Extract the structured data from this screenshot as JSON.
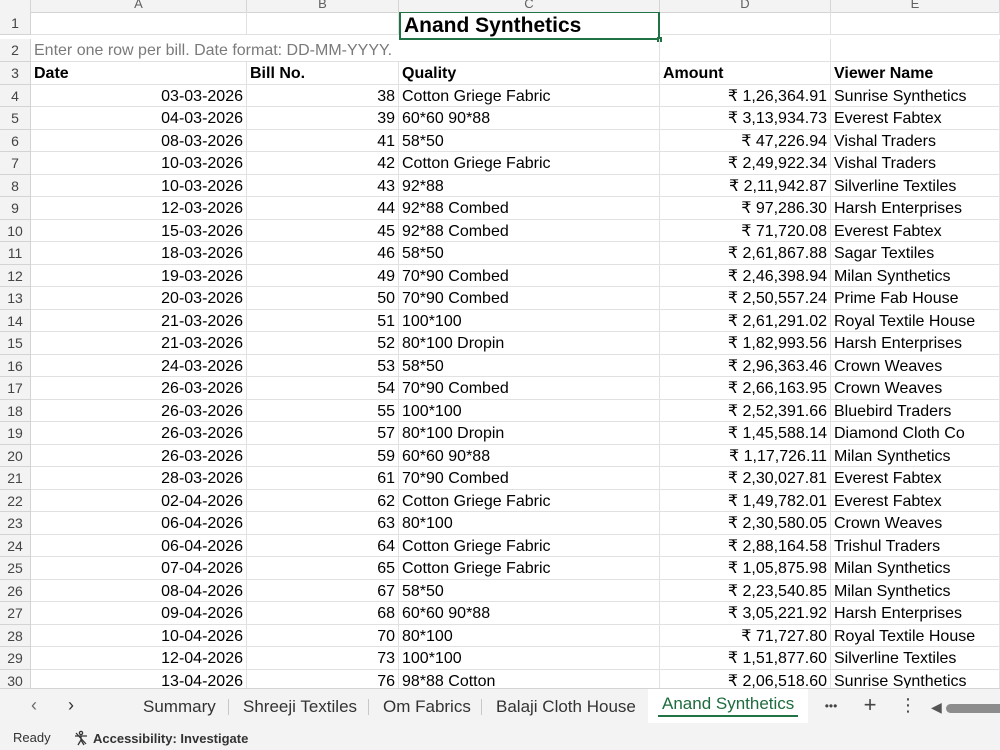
{
  "columns": [
    "A",
    "B",
    "C",
    "D",
    "E"
  ],
  "title": "Anand Synthetics",
  "note": "Enter one row per bill. Date format: DD-MM-YYYY.",
  "headers": {
    "date": "Date",
    "bill": "Bill No.",
    "quality": "Quality",
    "amount": "Amount",
    "viewer": "Viewer Name"
  },
  "rows": [
    {
      "date": "03-03-2026",
      "bill": "38",
      "quality": "Cotton Griege Fabric",
      "amount": "₹ 1,26,364.91",
      "viewer": "Sunrise Synthetics"
    },
    {
      "date": "04-03-2026",
      "bill": "39",
      "quality": "60*60 90*88",
      "amount": "₹ 3,13,934.73",
      "viewer": "Everest Fabtex"
    },
    {
      "date": "08-03-2026",
      "bill": "41",
      "quality": "58*50",
      "amount": "₹ 47,226.94",
      "viewer": "Vishal Traders"
    },
    {
      "date": "10-03-2026",
      "bill": "42",
      "quality": "Cotton Griege Fabric",
      "amount": "₹ 2,49,922.34",
      "viewer": "Vishal Traders"
    },
    {
      "date": "10-03-2026",
      "bill": "43",
      "quality": "92*88",
      "amount": "₹ 2,11,942.87",
      "viewer": "Silverline Textiles"
    },
    {
      "date": "12-03-2026",
      "bill": "44",
      "quality": "92*88 Combed",
      "amount": "₹ 97,286.30",
      "viewer": "Harsh Enterprises"
    },
    {
      "date": "15-03-2026",
      "bill": "45",
      "quality": "92*88 Combed",
      "amount": "₹ 71,720.08",
      "viewer": "Everest Fabtex"
    },
    {
      "date": "18-03-2026",
      "bill": "46",
      "quality": "58*50",
      "amount": "₹ 2,61,867.88",
      "viewer": "Sagar Textiles"
    },
    {
      "date": "19-03-2026",
      "bill": "49",
      "quality": "70*90 Combed",
      "amount": "₹ 2,46,398.94",
      "viewer": "Milan Synthetics"
    },
    {
      "date": "20-03-2026",
      "bill": "50",
      "quality": "70*90 Combed",
      "amount": "₹ 2,50,557.24",
      "viewer": "Prime Fab House"
    },
    {
      "date": "21-03-2026",
      "bill": "51",
      "quality": "100*100",
      "amount": "₹ 2,61,291.02",
      "viewer": "Royal Textile House"
    },
    {
      "date": "21-03-2026",
      "bill": "52",
      "quality": "80*100 Dropin",
      "amount": "₹ 1,82,993.56",
      "viewer": "Harsh Enterprises"
    },
    {
      "date": "24-03-2026",
      "bill": "53",
      "quality": "58*50",
      "amount": "₹ 2,96,363.46",
      "viewer": "Crown Weaves"
    },
    {
      "date": "26-03-2026",
      "bill": "54",
      "quality": "70*90 Combed",
      "amount": "₹ 2,66,163.95",
      "viewer": "Crown Weaves"
    },
    {
      "date": "26-03-2026",
      "bill": "55",
      "quality": "100*100",
      "amount": "₹ 2,52,391.66",
      "viewer": "Bluebird Traders"
    },
    {
      "date": "26-03-2026",
      "bill": "57",
      "quality": "80*100 Dropin",
      "amount": "₹ 1,45,588.14",
      "viewer": "Diamond Cloth Co"
    },
    {
      "date": "26-03-2026",
      "bill": "59",
      "quality": "60*60 90*88",
      "amount": "₹ 1,17,726.11",
      "viewer": "Milan Synthetics"
    },
    {
      "date": "28-03-2026",
      "bill": "61",
      "quality": "70*90 Combed",
      "amount": "₹ 2,30,027.81",
      "viewer": "Everest Fabtex"
    },
    {
      "date": "02-04-2026",
      "bill": "62",
      "quality": "Cotton Griege Fabric",
      "amount": "₹ 1,49,782.01",
      "viewer": "Everest Fabtex"
    },
    {
      "date": "06-04-2026",
      "bill": "63",
      "quality": "80*100",
      "amount": "₹ 2,30,580.05",
      "viewer": "Crown Weaves"
    },
    {
      "date": "06-04-2026",
      "bill": "64",
      "quality": "Cotton Griege Fabric",
      "amount": "₹ 2,88,164.58",
      "viewer": "Trishul Traders"
    },
    {
      "date": "07-04-2026",
      "bill": "65",
      "quality": "Cotton Griege Fabric",
      "amount": "₹ 1,05,875.98",
      "viewer": "Milan Synthetics"
    },
    {
      "date": "08-04-2026",
      "bill": "67",
      "quality": "58*50",
      "amount": "₹ 2,23,540.85",
      "viewer": "Milan Synthetics"
    },
    {
      "date": "09-04-2026",
      "bill": "68",
      "quality": "60*60 90*88",
      "amount": "₹ 3,05,221.92",
      "viewer": "Harsh Enterprises"
    },
    {
      "date": "10-04-2026",
      "bill": "70",
      "quality": "80*100",
      "amount": "₹ 71,727.80",
      "viewer": "Royal Textile House"
    },
    {
      "date": "12-04-2026",
      "bill": "73",
      "quality": "100*100",
      "amount": "₹ 1,51,877.60",
      "viewer": "Silverline Textiles"
    },
    {
      "date": "13-04-2026",
      "bill": "76",
      "quality": "98*88 Cotton",
      "amount": "₹ 2,06,518.60",
      "viewer": "Sunrise Synthetics"
    }
  ],
  "sheet_tabs": [
    "Summary",
    "Shreeji Textiles",
    "Om Fabrics",
    "Balaji Cloth House",
    "Anand Synthetics"
  ],
  "active_tab": "Anand Synthetics",
  "nav": {
    "prev": "‹",
    "next": "›",
    "more": "•••",
    "add": "+",
    "options": "⋮",
    "scroll_left": "◀"
  },
  "status": {
    "ready": "Ready",
    "accessibility": "Accessibility: Investigate"
  },
  "colors": {
    "accent": "#217346",
    "header_bg": "#f3f3f3",
    "grid_line": "#e1e1e1"
  }
}
